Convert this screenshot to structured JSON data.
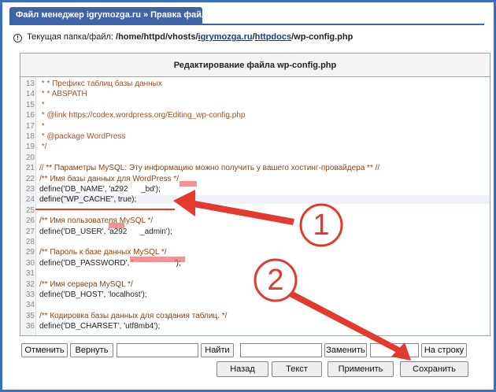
{
  "tab": {
    "title": "Файл менеджер igrymozga.ru » Правка файла"
  },
  "path": {
    "label": "Текущая папка/файл:",
    "prefix": "/home/httpd/vhosts/",
    "part1": "igrymozga.ru",
    "sep": "/",
    "part2": "httpdocs",
    "file": "/wp-config.php"
  },
  "panel": {
    "header": "Редактирование файла wp-config.php"
  },
  "editor": {
    "lines": [
      {
        "n": "13",
        "t": " * * Префикс таблиц базы данных",
        "c": "cm"
      },
      {
        "n": "14",
        "t": " * * ABSPATH",
        "c": "cm"
      },
      {
        "n": "15",
        "t": " *",
        "c": "cm"
      },
      {
        "n": "16",
        "t": " * @link https://codex.wordpress.org/Editing_wp-config.php",
        "c": "cm"
      },
      {
        "n": "17",
        "t": " *",
        "c": "cm"
      },
      {
        "n": "18",
        "t": " * @package WordPress",
        "c": "cm"
      },
      {
        "n": "19",
        "t": " */",
        "c": "cm"
      },
      {
        "n": "20",
        "t": "",
        "c": ""
      },
      {
        "n": "21",
        "t": "// ** Параметры MySQL: Эту информацию можно получить у вашего хостинг-провайдера ** //",
        "c": "ml"
      },
      {
        "n": "22",
        "t": "/** Имя базы данных для WordPress */",
        "c": "ml"
      },
      {
        "n": "23",
        "t": "define('DB_NAME', 'a292      _bd');",
        "c": "kw"
      },
      {
        "n": "24",
        "t": "define(\"WP_CACHE\", true);",
        "c": "kw"
      },
      {
        "n": "25",
        "t": "",
        "c": ""
      },
      {
        "n": "26",
        "t": "/** Имя пользователя MySQL */",
        "c": "ml"
      },
      {
        "n": "27",
        "t": "define('DB_USER', 'a292      _admin');",
        "c": "kw"
      },
      {
        "n": "28",
        "t": "",
        "c": ""
      },
      {
        "n": "29",
        "t": "/** Пароль к базе данных MySQL */",
        "c": "ml"
      },
      {
        "n": "30",
        "t": "define('DB_PASSWORD', '                   ');",
        "c": "kw"
      },
      {
        "n": "31",
        "t": "",
        "c": ""
      },
      {
        "n": "32",
        "t": "/** Имя сервера MySQL */",
        "c": "ml"
      },
      {
        "n": "33",
        "t": "define('DB_HOST', 'localhost');",
        "c": "kw"
      },
      {
        "n": "34",
        "t": "",
        "c": ""
      },
      {
        "n": "35",
        "t": "/** Кодировка базы данных для создания таблиц. */",
        "c": "ml"
      },
      {
        "n": "36",
        "t": "define('DB_CHARSET', 'utf8mb4');",
        "c": "kw"
      }
    ]
  },
  "toolbar": {
    "cancel": "Отменить",
    "redo": "Вернуть",
    "find": "Найти",
    "replace": "Заменить",
    "goto_line": "На строку"
  },
  "bottom": {
    "back": "Назад",
    "text": "Текст",
    "apply": "Применить",
    "save": "Сохранить"
  },
  "annotations": {
    "one": "1",
    "two": "2"
  },
  "colors": {
    "accent": "#3d64a6",
    "annotation": "#e8392f"
  }
}
